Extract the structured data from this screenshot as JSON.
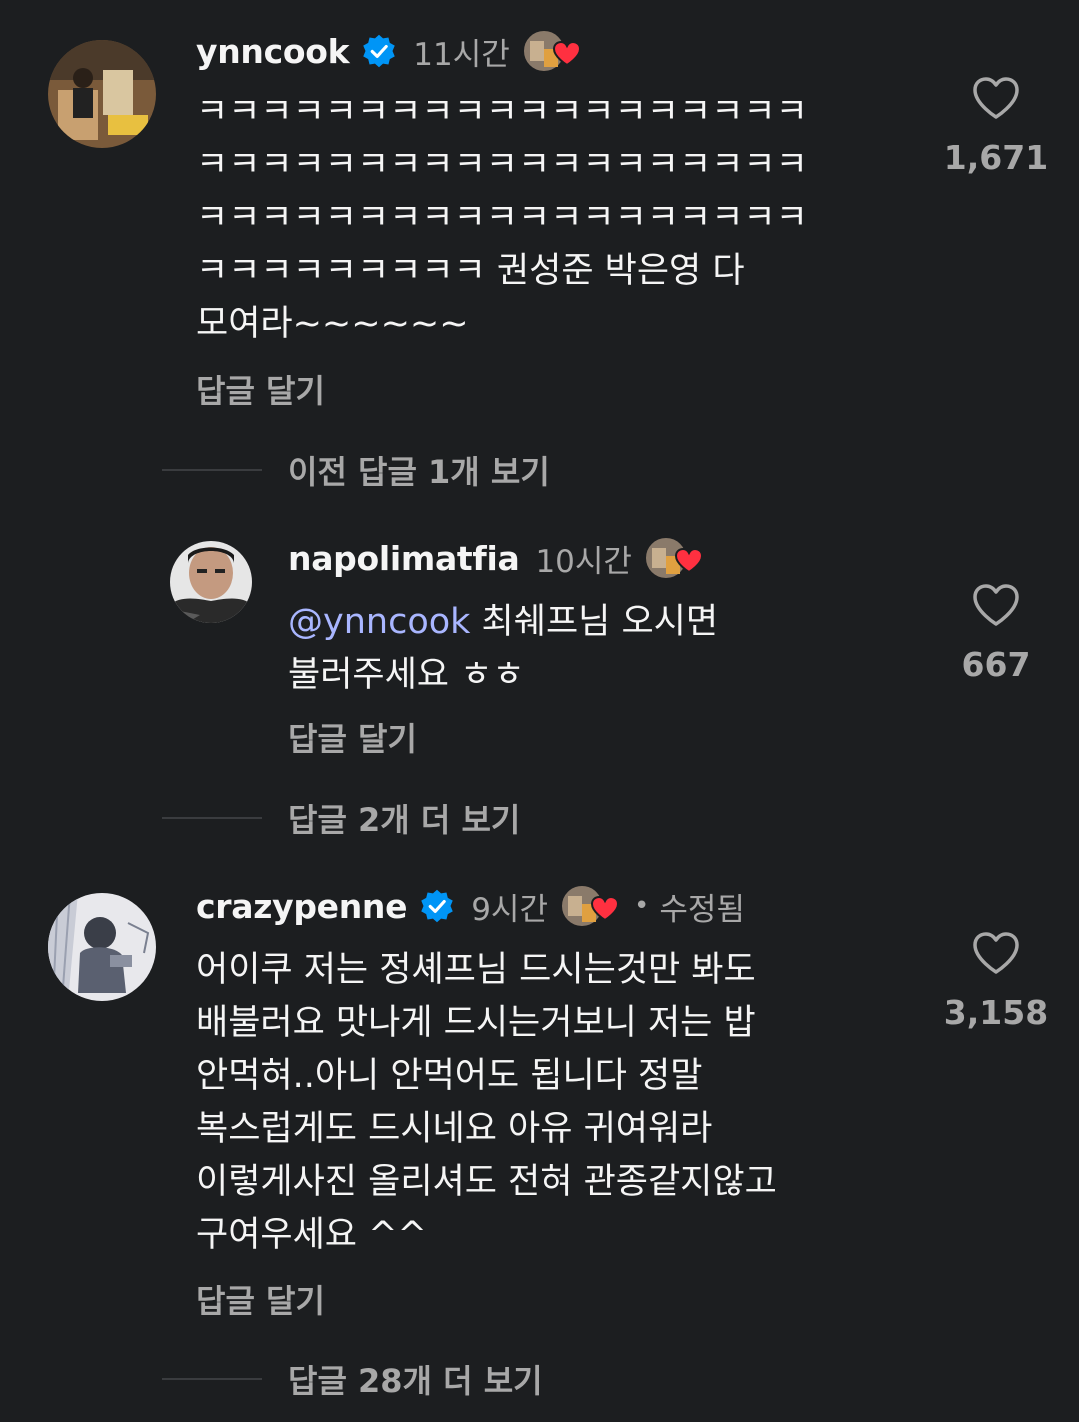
{
  "comments": [
    {
      "username": "ynncook",
      "verified": true,
      "time": "11시간",
      "text": "ㅋㅋㅋㅋㅋㅋㅋㅋㅋㅋㅋㅋㅋㅋㅋㅋㅋㅋㅋ\nㅋㅋㅋㅋㅋㅋㅋㅋㅋㅋㅋㅋㅋㅋㅋㅋㅋㅋㅋ\nㅋㅋㅋㅋㅋㅋㅋㅋㅋㅋㅋㅋㅋㅋㅋㅋㅋㅋㅋ\nㅋㅋㅋㅋㅋㅋㅋㅋㅋ 권성준 박은영 다\n모여라~~~~~~",
      "reply_label": "답글 달기",
      "likes": "1,671"
    },
    {
      "username": "napolimatfia",
      "verified": false,
      "time": "10시간",
      "mention": "@ynncook",
      "text_after_mention": " 최쉐프님 오시면\n불러주세요 ㅎㅎ",
      "reply_label": "답글 달기",
      "likes": "667"
    },
    {
      "username": "crazypenne",
      "verified": true,
      "time": "9시간",
      "edited_dot": "•",
      "edited": "수정됨",
      "text": "어이쿠 저는 정셰프님 드시는것만 봐도\n배불러요 맛나게 드시는거보니 저는 밥\n안먹혀..아니 안먹어도 됩니다 정말\n복스럽게도 드시네요 아유 귀여워라\n이렇게사진 올리셔도 전혀 관종같지않고\n구여우세요 ^^",
      "reply_label": "답글 달기",
      "likes": "3,158"
    }
  ],
  "view_more": {
    "previous_replies": "이전 답글 1개 보기",
    "more_replies_1": "답글 2개 더 보기",
    "more_replies_2": "답글 28개 더 보기"
  },
  "colors": {
    "background": "#1c1e20",
    "text": "#f5f5f5",
    "secondary": "#a8a8a8",
    "mention": "#a9b6ff",
    "verified": "#0095f6",
    "heart_red": "#ff3040"
  },
  "icons": {
    "heart": "heart-outline-icon",
    "verified": "verified-badge-icon",
    "creator_like": "creator-liked-icon"
  }
}
